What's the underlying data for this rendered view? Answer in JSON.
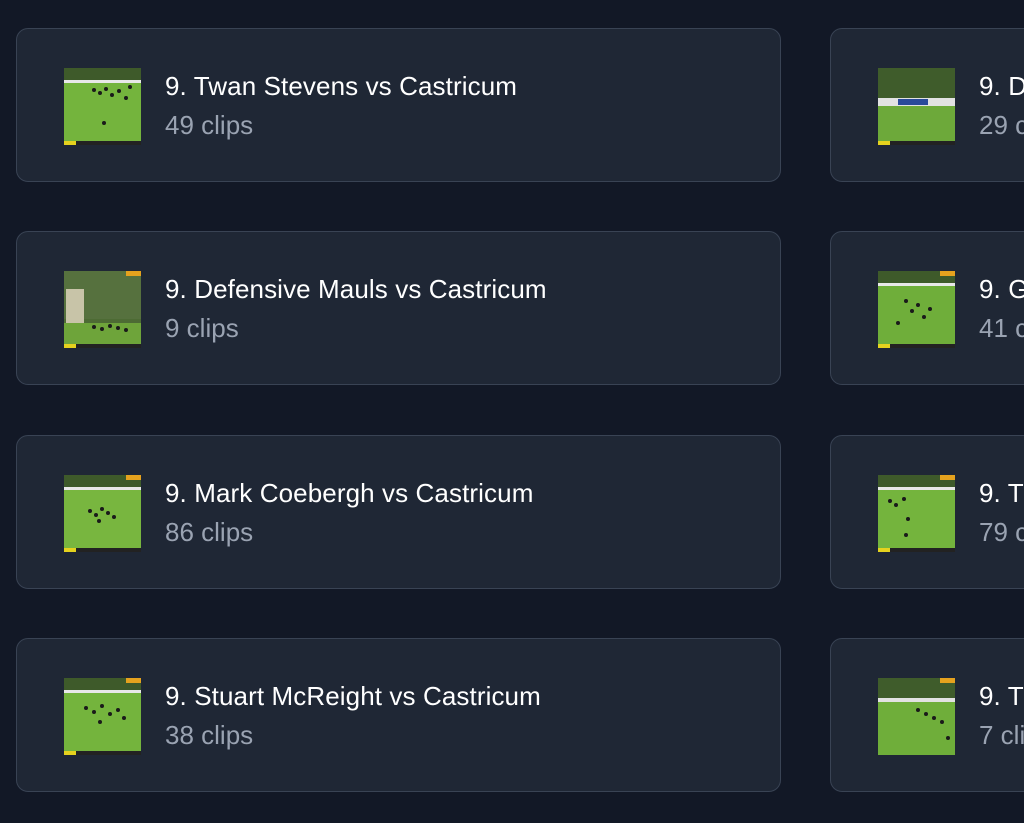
{
  "playlists": {
    "left": [
      {
        "title": "9. Twan Stevens vs Castricum",
        "count": "49 clips"
      },
      {
        "title": "9. Defensive Mauls vs Castricum",
        "count": "9 clips"
      },
      {
        "title": "9. Mark Coebergh vs Castricum",
        "count": "86 clips"
      },
      {
        "title": "9. Stuart McReight vs Castricum",
        "count": "38 clips"
      }
    ],
    "right": [
      {
        "title": "9. D",
        "count": "29 c"
      },
      {
        "title": "9. G",
        "count": "41 c"
      },
      {
        "title": "9. T",
        "count": "79 c"
      },
      {
        "title": "9. T",
        "count": "7 cli"
      }
    ]
  },
  "icons": {
    "thumbnail": "rugby-match-thumbnail"
  },
  "colors": {
    "background": "#121826",
    "card": "#1f2735",
    "card_border": "#394354",
    "title": "#ffffff",
    "count": "#9aa3b2",
    "pitch": "#6fae3a"
  }
}
